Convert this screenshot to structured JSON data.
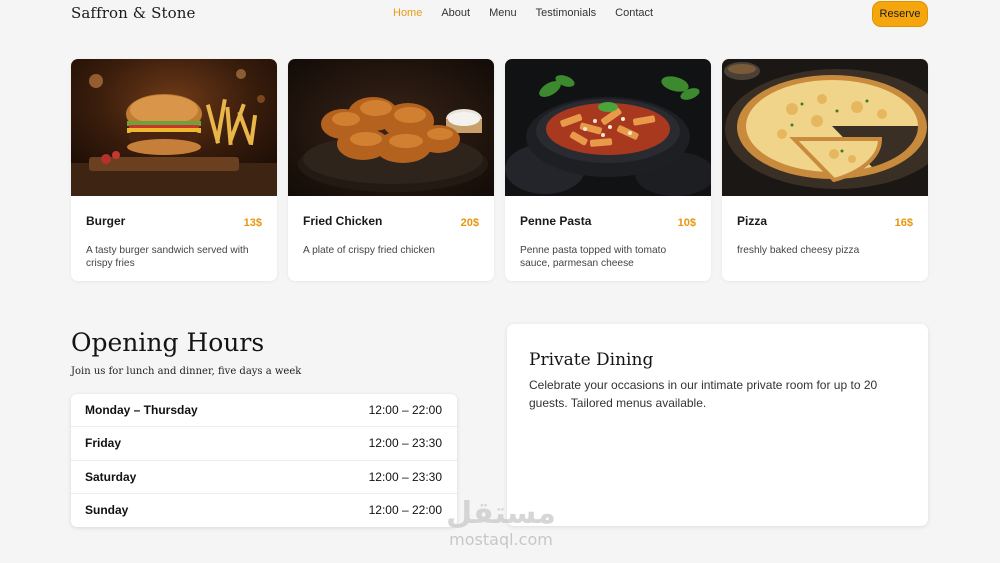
{
  "nav": {
    "brand": "Saffron & Stone",
    "links": [
      "Home",
      "About",
      "Menu",
      "Testimonials",
      "Contact"
    ],
    "active": "Home",
    "reserve_label": "Reserve",
    "accent_color": "#f5a60d"
  },
  "menu": {
    "items": [
      {
        "name": "Burger",
        "price": "13$",
        "description": "A tasty burger sandwich served with crispy fries",
        "image_icon": "burger-photo"
      },
      {
        "name": "Fried Chicken",
        "price": "20$",
        "description": "A plate of crispy fried chicken",
        "image_icon": "fried-chicken-photo"
      },
      {
        "name": "Penne Pasta",
        "price": "10$",
        "description": "Penne pasta topped with tomato sauce, parmesan cheese",
        "image_icon": "pasta-photo"
      },
      {
        "name": "Pizza",
        "price": "16$",
        "description": "freshly baked cheesy pizza",
        "image_icon": "pizza-photo"
      }
    ],
    "price_color": "#e8950e"
  },
  "hours": {
    "title": "Opening Hours",
    "subtitle": "Join us for lunch and dinner, five days a week",
    "rows": [
      {
        "day": "Monday – Thursday",
        "time": "12:00 – 22:00"
      },
      {
        "day": "Friday",
        "time": "12:00 – 23:30"
      },
      {
        "day": "Saturday",
        "time": "12:00 – 23:30"
      },
      {
        "day": "Sunday",
        "time": "12:00 – 22:00"
      }
    ]
  },
  "private_dining": {
    "title": "Private Dining",
    "text": "Celebrate your occasions in our intimate private room for up to 20 guests. Tailored menus available."
  },
  "watermark": {
    "arabic": "مستقل",
    "latin": "mostaql.com"
  }
}
